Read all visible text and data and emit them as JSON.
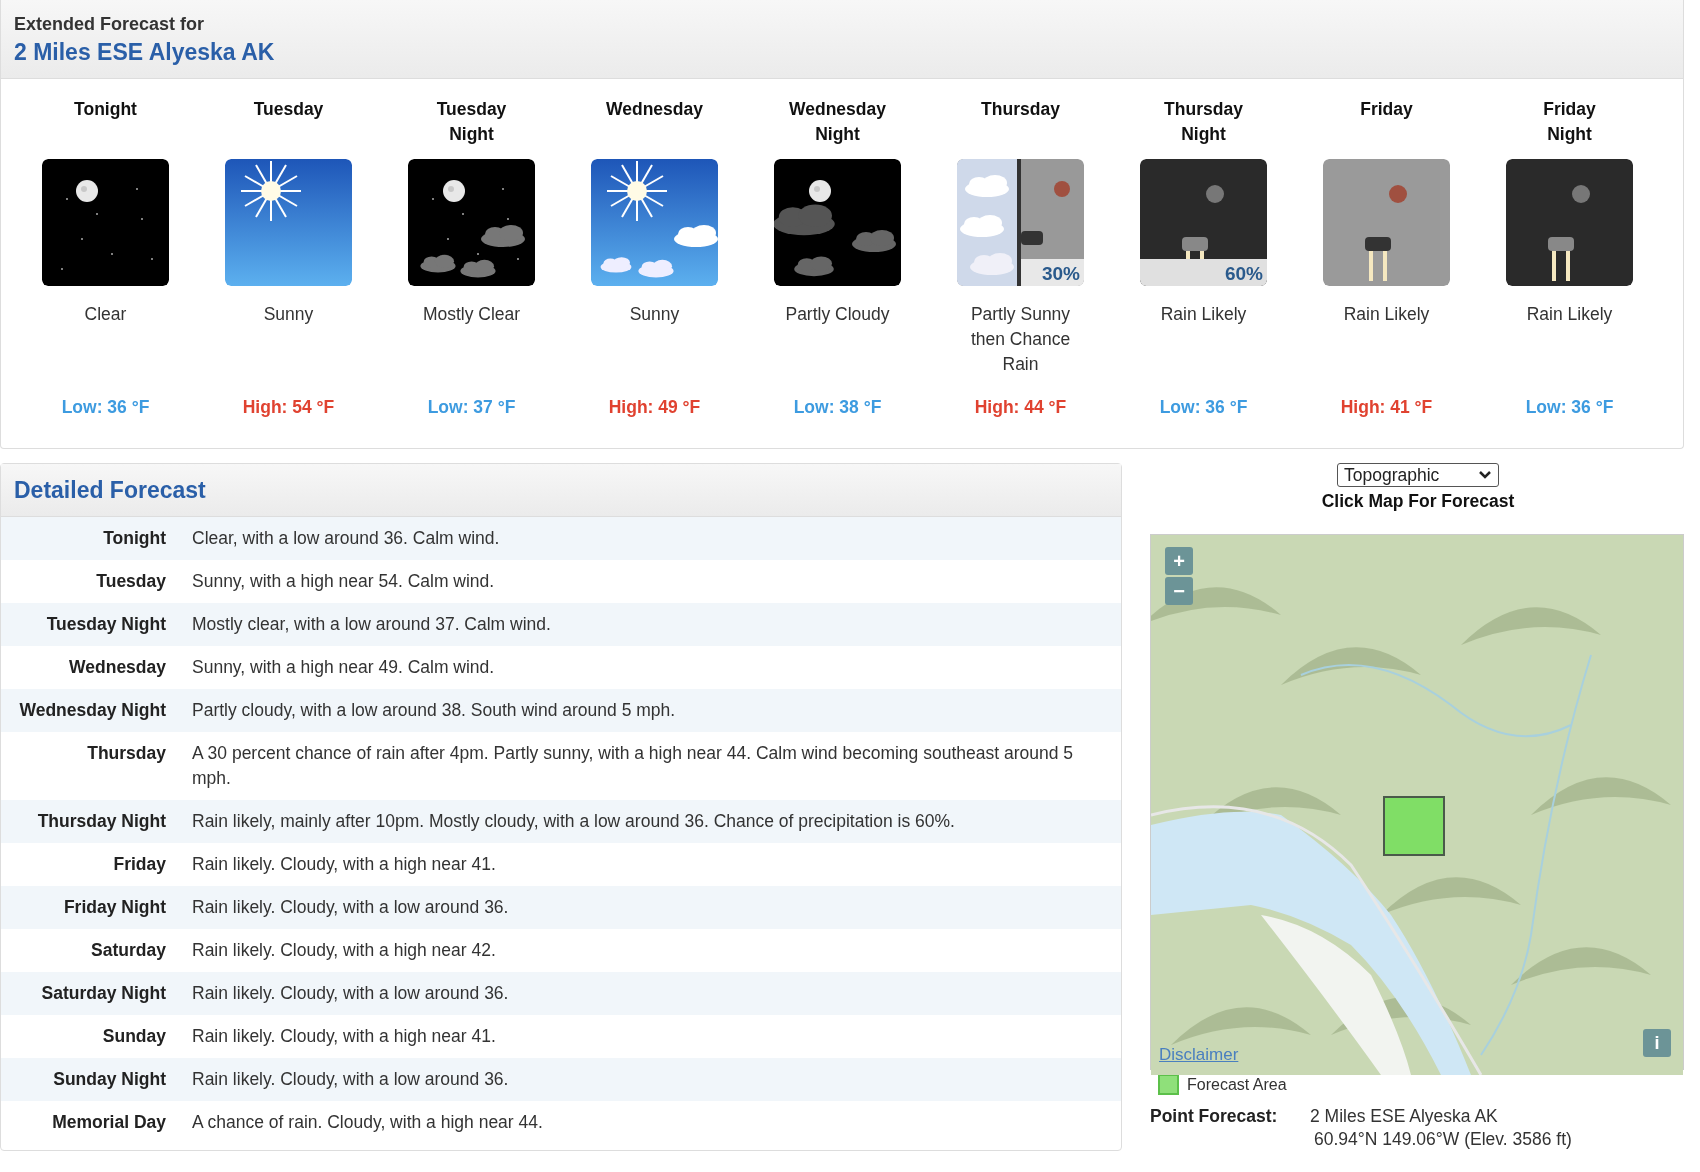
{
  "header": {
    "subtitle": "Extended Forecast for",
    "location": "2 Miles ESE Alyeska AK"
  },
  "periods": [
    {
      "name": "Tonight",
      "kind": "night_clear",
      "short": "Clear",
      "temp": {
        "kind": "low",
        "text": "Low: 36 °F"
      }
    },
    {
      "name": "Tuesday",
      "kind": "sunny",
      "short": "Sunny",
      "temp": {
        "kind": "high",
        "text": "High: 54 °F"
      }
    },
    {
      "name": "Tuesday Night",
      "kind": "night_few_clouds",
      "short": "Mostly Clear",
      "temp": {
        "kind": "low",
        "text": "Low: 37 °F"
      }
    },
    {
      "name": "Wednesday",
      "kind": "sunny_few_clouds",
      "short": "Sunny",
      "temp": {
        "kind": "high",
        "text": "High: 49 °F"
      }
    },
    {
      "name": "Wednesday Night",
      "kind": "night_clouds",
      "short": "Partly Cloudy",
      "temp": {
        "kind": "low",
        "text": "Low: 38 °F"
      }
    },
    {
      "name": "Thursday",
      "kind": "clouds_then_rain",
      "chance": "30%",
      "short": "Partly Sunny then Chance Rain",
      "temp": {
        "kind": "high",
        "text": "High: 44 °F"
      }
    },
    {
      "name": "Thursday Night",
      "kind": "rain_night",
      "chance": "60%",
      "short": "Rain Likely",
      "temp": {
        "kind": "low",
        "text": "Low: 36 °F"
      }
    },
    {
      "name": "Friday",
      "kind": "rain_day",
      "short": "Rain Likely",
      "temp": {
        "kind": "high",
        "text": "High: 41 °F"
      }
    },
    {
      "name": "Friday Night",
      "kind": "rain_night",
      "short": "Rain Likely",
      "temp": {
        "kind": "low",
        "text": "Low: 36 °F"
      }
    }
  ],
  "detailed": {
    "title": "Detailed Forecast",
    "rows": [
      {
        "label": "Tonight",
        "text": "Clear, with a low around 36. Calm wind."
      },
      {
        "label": "Tuesday",
        "text": "Sunny, with a high near 54. Calm wind."
      },
      {
        "label": "Tuesday Night",
        "text": "Mostly clear, with a low around 37. Calm wind."
      },
      {
        "label": "Wednesday",
        "text": "Sunny, with a high near 49. Calm wind."
      },
      {
        "label": "Wednesday Night",
        "text": "Partly cloudy, with a low around 38. South wind around 5 mph."
      },
      {
        "label": "Thursday",
        "text": "A 30 percent chance of rain after 4pm. Partly sunny, with a high near 44. Calm wind becoming southeast around 5 mph."
      },
      {
        "label": "Thursday Night",
        "text": "Rain likely, mainly after 10pm. Mostly cloudy, with a low around 36. Chance of precipitation is 60%."
      },
      {
        "label": "Friday",
        "text": "Rain likely. Cloudy, with a high near 41."
      },
      {
        "label": "Friday Night",
        "text": "Rain likely. Cloudy, with a low around 36."
      },
      {
        "label": "Saturday",
        "text": "Rain likely. Cloudy, with a high near 42."
      },
      {
        "label": "Saturday Night",
        "text": "Rain likely. Cloudy, with a low around 36."
      },
      {
        "label": "Sunday",
        "text": "Rain likely. Cloudy, with a high near 41."
      },
      {
        "label": "Sunday Night",
        "text": "Rain likely. Cloudy, with a low around 36."
      },
      {
        "label": "Memorial Day",
        "text": "A chance of rain. Cloudy, with a high near 44."
      }
    ]
  },
  "map": {
    "layer_select": "Topographic",
    "hint": "Click Map For Forecast",
    "zoom_in": "+",
    "zoom_out": "−",
    "info": "i",
    "disclaimer": "Disclaimer",
    "legend": "Forecast Area"
  },
  "point_forecast": {
    "label": "Point Forecast:",
    "location": "2 Miles ESE Alyeska AK",
    "coords": "60.94°N 149.06°W (Elev. 3586 ft)"
  }
}
